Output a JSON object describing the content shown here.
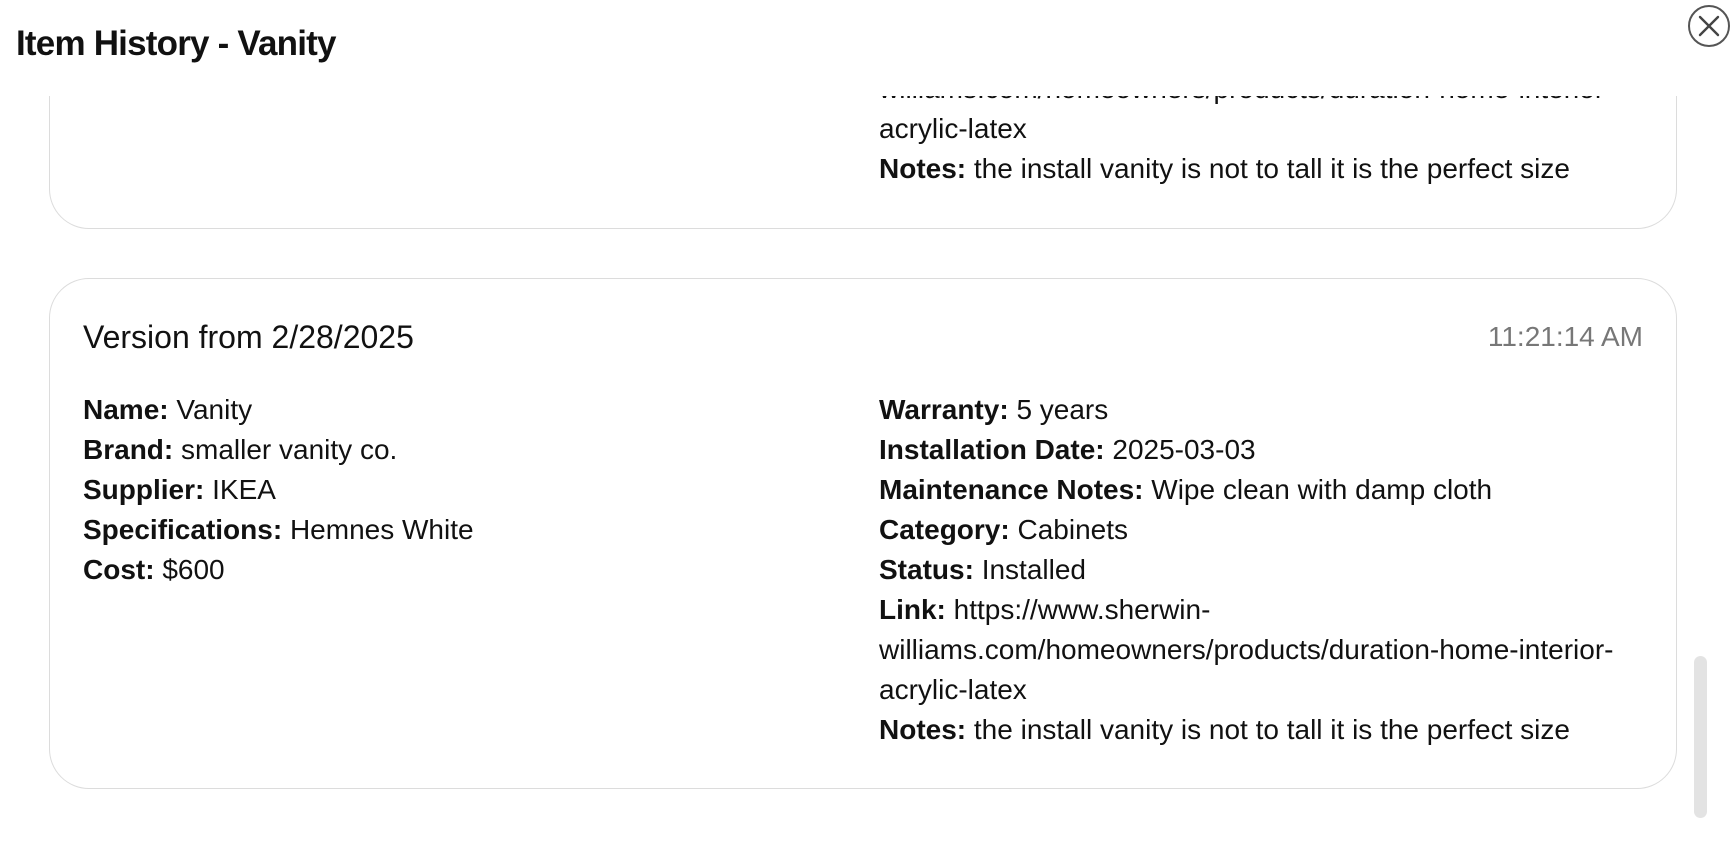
{
  "modal": {
    "title": "Item History - Vanity"
  },
  "versions": [
    {
      "title": "",
      "time": "",
      "right": [
        {
          "label": "",
          "value": "williams.com/homeowners/products/duration-home-interior-acrylic-latex"
        },
        {
          "label": "Notes:",
          "value": "the install vanity is not to tall it is the perfect size"
        }
      ]
    },
    {
      "title": "Version from 2/28/2025",
      "time": "11:21:14 AM",
      "left": [
        {
          "label": "Name:",
          "value": "Vanity"
        },
        {
          "label": "Brand:",
          "value": "smaller vanity co."
        },
        {
          "label": "Supplier:",
          "value": "IKEA"
        },
        {
          "label": "Specifications:",
          "value": "Hemnes White"
        },
        {
          "label": "Cost:",
          "value": "$600"
        }
      ],
      "right": [
        {
          "label": "Warranty:",
          "value": "5 years"
        },
        {
          "label": "Installation Date:",
          "value": "2025-03-03"
        },
        {
          "label": "Maintenance Notes:",
          "value": "Wipe clean with damp cloth"
        },
        {
          "label": "Category:",
          "value": "Cabinets"
        },
        {
          "label": "Status:",
          "value": "Installed"
        },
        {
          "label": "Link:",
          "value": "https://www.sherwin-williams.com/homeowners/products/duration-home-interior-acrylic-latex"
        },
        {
          "label": "Notes:",
          "value": "the install vanity is not to tall it is the perfect size"
        }
      ]
    }
  ],
  "icons": {
    "close": "close-icon"
  },
  "colors": {
    "card_border": "#dcdcdc",
    "time_text": "#777777",
    "scrollbar": "#e3e3e3"
  }
}
